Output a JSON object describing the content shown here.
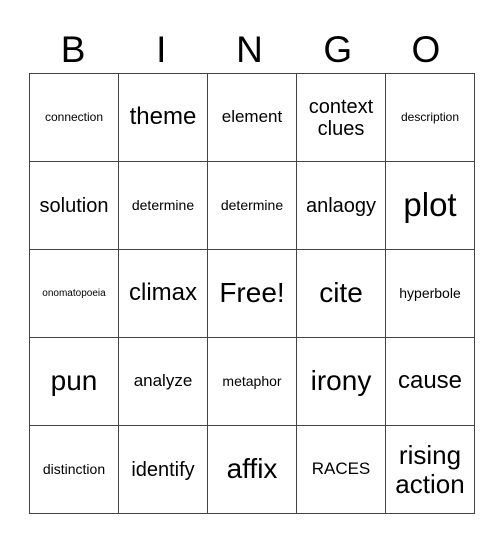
{
  "header": {
    "letters": [
      "B",
      "I",
      "N",
      "G",
      "O"
    ]
  },
  "board": {
    "rows": [
      [
        "connection",
        "theme",
        "element",
        "context clues",
        "description"
      ],
      [
        "solution",
        "determine",
        "determine",
        "anlaogy",
        "plot"
      ],
      [
        "onomatopoeia",
        "climax",
        "Free!",
        "cite",
        "hyperbole"
      ],
      [
        "pun",
        "analyze",
        "metaphor",
        "irony",
        "cause"
      ],
      [
        "distinction",
        "identify",
        "affix",
        "RACES",
        "rising action"
      ]
    ],
    "free_space": "Free!"
  }
}
